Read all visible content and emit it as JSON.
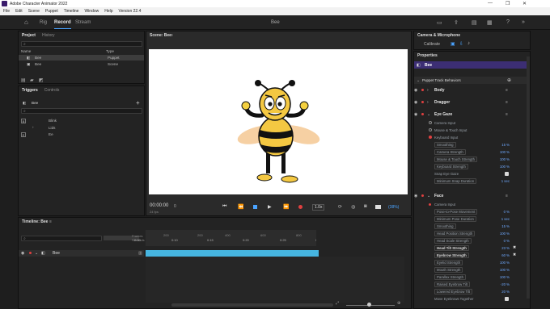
{
  "app": {
    "title": "Adobe Character Animator 2022"
  },
  "menu": [
    "File",
    "Edit",
    "Scene",
    "Puppet",
    "Timeline",
    "Window",
    "Help",
    "Version 22.4"
  ],
  "modes": {
    "rig": "Rig",
    "record": "Record",
    "stream": "Stream"
  },
  "scene_name_header": "Bee",
  "project": {
    "tab_project": "Project",
    "tab_history": "History",
    "col_name": "Name",
    "col_type": "Type",
    "items": [
      {
        "name": "Bee",
        "type": "Puppet"
      },
      {
        "name": "Bee",
        "type": "Scene"
      }
    ]
  },
  "triggers": {
    "tab_triggers": "Triggers",
    "tab_controls": "Controls",
    "puppet": "Bee",
    "items": [
      {
        "key": "B",
        "name": "Blink"
      },
      {
        "key": "",
        "name": "Lids"
      },
      {
        "key": "E",
        "name": "Ee"
      }
    ]
  },
  "scene": {
    "tab": "Scene: Bee"
  },
  "transport": {
    "timecode": "00:00:00",
    "frame": "0",
    "fps": "24 fps",
    "speed": "1.0x",
    "zoom": "(38%)"
  },
  "timeline": {
    "tab": "Timeline: Bee",
    "frames_label": "Frames",
    "seconds_label": "Seconds",
    "ticks": [
      "0:00",
      "200",
      "0:10",
      "200",
      "0:15",
      "400",
      "0:20",
      "600",
      "0:25",
      "800",
      "0:30",
      "1000",
      "1200",
      "1400"
    ],
    "track": "Bee"
  },
  "camera": {
    "title": "Camera & Microphone",
    "calibrate": "Calibrate"
  },
  "properties": {
    "title": "Properties",
    "puppet": "Bee",
    "group": "Puppet Track Behaviors",
    "behaviors": [
      {
        "name": "Body"
      },
      {
        "name": "Dragger"
      },
      {
        "name": "Eye Gaze"
      },
      {
        "name": "Face"
      }
    ],
    "eye_gaze": {
      "inputs": [
        "Camera Input",
        "Mouse & Touch Input",
        "Keyboard Input"
      ],
      "params": [
        {
          "label": "Smoothing",
          "value": "15 %"
        },
        {
          "label": "Camera Strength",
          "value": "100 %"
        },
        {
          "label": "Mouse & Touch Strength",
          "value": "100 %"
        },
        {
          "label": "Keyboard Strength",
          "value": "100 %"
        },
        {
          "label": "Snap Eye Gaze",
          "value": ""
        },
        {
          "label": "Minimum Snap Duration",
          "value": "1 sec"
        }
      ]
    },
    "face": {
      "inputs": [
        "Camera Input"
      ],
      "params": [
        {
          "label": "Pose-to-Pose Movement",
          "value": "0 %"
        },
        {
          "label": "Minimum Pose Duration",
          "value": "1 sec"
        },
        {
          "label": "Smoothing",
          "value": "15 %"
        },
        {
          "label": "Head Position Strength",
          "value": "100 %"
        },
        {
          "label": "Head Scale Strength",
          "value": "0 %"
        },
        {
          "label": "Head Tilt Strength",
          "value": "23 %"
        },
        {
          "label": "Eyebrow Strength",
          "value": "60 %"
        },
        {
          "label": "Eyelid Strength",
          "value": "100 %"
        },
        {
          "label": "Mouth Strength",
          "value": "100 %"
        },
        {
          "label": "Parallax Strength",
          "value": "100 %"
        },
        {
          "label": "Raised Eyebrow Tilt",
          "value": "-20 %"
        },
        {
          "label": "Lowered Eyebrow Tilt",
          "value": "20 %"
        },
        {
          "label": "Move Eyebrows Together",
          "value": ""
        }
      ]
    }
  },
  "colors": {
    "accent": "#4aa3ff",
    "track": "#46b5e0",
    "record_red": "#e04040",
    "purple": "#3c2e74"
  }
}
